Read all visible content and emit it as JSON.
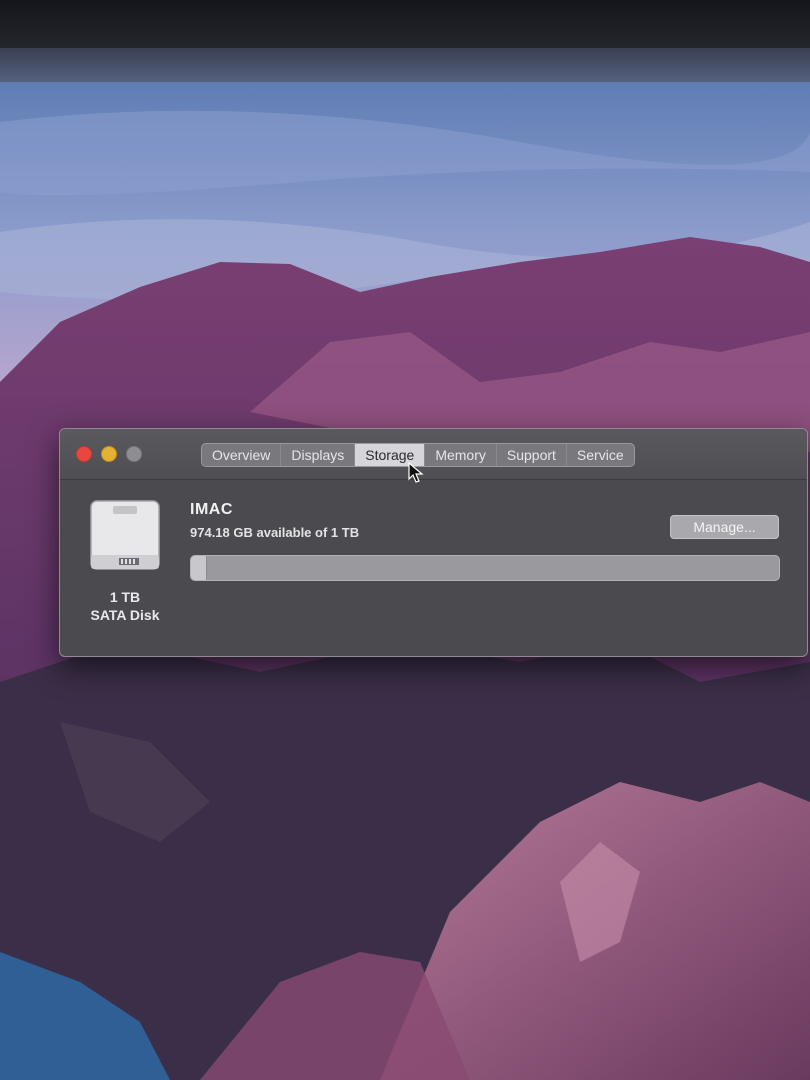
{
  "window": {
    "tabs": [
      {
        "label": "Overview",
        "active": false
      },
      {
        "label": "Displays",
        "active": false
      },
      {
        "label": "Storage",
        "active": true
      },
      {
        "label": "Memory",
        "active": false
      },
      {
        "label": "Support",
        "active": false
      },
      {
        "label": "Service",
        "active": false
      }
    ],
    "traffic_lights": {
      "close_color": "#e8473f",
      "minimize_color": "#e5b133",
      "zoom_color": "#8e8d92"
    }
  },
  "disk": {
    "icon": "hard-drive-icon",
    "size_label": "1 TB",
    "type_label": "SATA Disk"
  },
  "volume": {
    "name": "IMAC",
    "available_text": "974.18 GB available of 1 TB",
    "used_fraction": 0.026,
    "manage_label": "Manage..."
  }
}
